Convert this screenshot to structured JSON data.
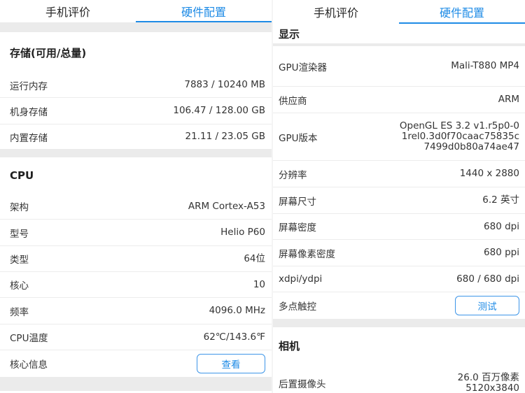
{
  "left": {
    "tabs": [
      "手机评价",
      "硬件配置"
    ],
    "storage": {
      "title": "存储(可用/总量)",
      "rows": [
        {
          "label": "运行内存",
          "value": "7883 / 10240 MB"
        },
        {
          "label": "机身存储",
          "value": "106.47 / 128.00 GB"
        },
        {
          "label": "内置存储",
          "value": "21.11 / 23.05 GB"
        }
      ]
    },
    "cpu": {
      "title": "CPU",
      "rows": [
        {
          "label": "架构",
          "value": "ARM Cortex-A53"
        },
        {
          "label": "型号",
          "value": "Helio P60"
        },
        {
          "label": "类型",
          "value": "64位"
        },
        {
          "label": "核心",
          "value": "10"
        },
        {
          "label": "频率",
          "value": "4096.0 MHz"
        },
        {
          "label": "CPU温度",
          "value": "62℃/143.6℉"
        }
      ],
      "core_info": {
        "label": "核心信息",
        "button": "查看"
      }
    }
  },
  "right": {
    "tabs": [
      "手机评价",
      "硬件配置"
    ],
    "display": {
      "title": "显示",
      "rows": [
        {
          "label": "GPU渲染器",
          "value": "Mali-T880 MP4"
        },
        {
          "label": "供应商",
          "value": "ARM"
        }
      ],
      "gpu_version": {
        "label": "GPU版本",
        "lines": [
          "OpenGL ES 3.2 v1.r5p0-0",
          "1rel0.3d0f70caac75835c",
          "7499d0b80a74ae47"
        ]
      },
      "rows2": [
        {
          "label": "分辨率",
          "value": "1440 x 2880"
        },
        {
          "label": "屏幕尺寸",
          "value": "6.2 英寸"
        },
        {
          "label": "屏幕密度",
          "value": "680 dpi"
        },
        {
          "label": "屏幕像素密度",
          "value": "680 ppi"
        },
        {
          "label": "xdpi/ydpi",
          "value": "680 / 680 dpi"
        }
      ],
      "multitouch": {
        "label": "多点触控",
        "button": "测试"
      }
    },
    "camera": {
      "title": "相机",
      "rear": {
        "label": "后置摄像头",
        "lines": [
          "26.0 百万像素",
          "5120x3840"
        ]
      }
    }
  },
  "colors": {
    "accent": "#1e8be6",
    "gap": "#ebebeb",
    "divider": "#ececec"
  }
}
